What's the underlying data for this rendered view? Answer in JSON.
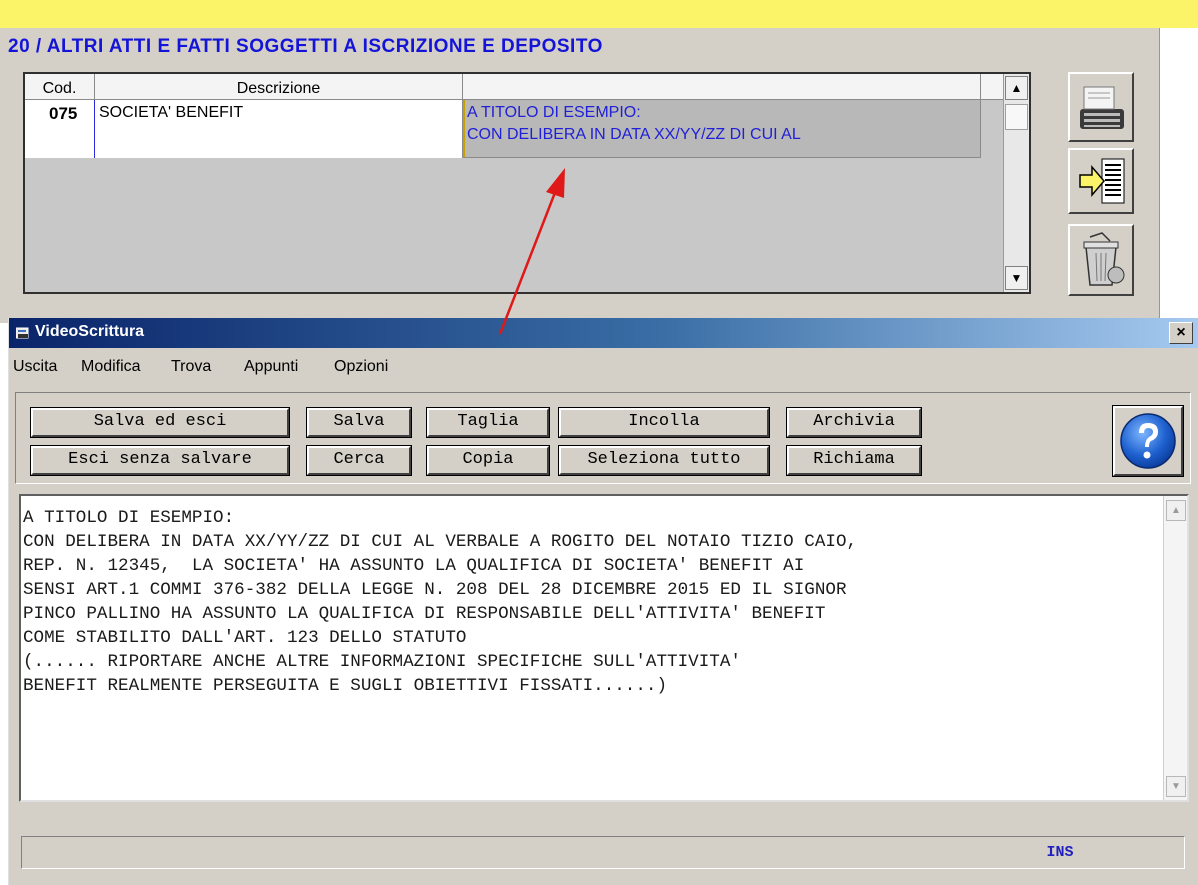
{
  "colors": {
    "accent_yellow": "#fcf468",
    "form_title_blue": "#1414d8",
    "memo_text_blue": "#2020d8",
    "titlebar_dark": "#0a246a",
    "annotation_red": "#e01818"
  },
  "form": {
    "section_title": "20 / ALTRI ATTI E FATTI SOGGETTI A ISCRIZIONE E DEPOSITO",
    "table": {
      "columns": [
        "Cod.",
        "Descrizione",
        ""
      ],
      "rows": [
        {
          "cod": "075",
          "descrizione": "SOCIETA' BENEFIT",
          "memo_lines": [
            "A TITOLO DI ESEMPIO:",
            "CON DELIBERA IN DATA XX/YY/ZZ DI CUI AL"
          ]
        }
      ]
    },
    "side_buttons": [
      "typewriter-icon",
      "insert-arrow-icon",
      "trash-bin-icon"
    ],
    "scroll_icons": {
      "up": "▲",
      "down": "▼"
    }
  },
  "dialog": {
    "title": "VideoScrittura",
    "close_label": "×",
    "menu": [
      "Uscita",
      "Modifica",
      "Trova",
      "Appunti",
      "Opzioni"
    ],
    "toolbar": {
      "salva_esci": "Salva ed esci",
      "salva": "Salva",
      "taglia": "Taglia",
      "incolla": "Incolla",
      "archivia": "Archivia",
      "esci_senza_salvare": "Esci senza salvare",
      "cerca": "Cerca",
      "copia": "Copia",
      "seleziona_tutto": "Seleziona tutto",
      "richiama": "Richiama"
    },
    "help_icon": "help-question-icon",
    "editor": {
      "lines": [
        "A TITOLO DI ESEMPIO:",
        "CON DELIBERA IN DATA XX/YY/ZZ DI CUI AL VERBALE A ROGITO DEL NOTAIO TIZIO CAIO,",
        "REP. N. 12345,  LA SOCIETA' HA ASSUNTO LA QUALIFICA DI SOCIETA' BENEFIT AI",
        "SENSI ART.1 COMMI 376-382 DELLA LEGGE N. 208 DEL 28 DICEMBRE 2015 ED IL SIGNOR",
        "PINCO PALLINO HA ASSUNTO LA QUALIFICA DI RESPONSABILE DELL'ATTIVITA' BENEFIT",
        "COME STABILITO DALL'ART. 123 DELLO STATUTO",
        "(...... RIPORTARE ANCHE ALTRE INFORMAZIONI SPECIFICHE SULL'ATTIVITA'",
        "BENEFIT REALMENTE PERSEGUITA E SUGLI OBIETTIVI FISSATI......)"
      ],
      "scroll_up": "▲",
      "scroll_down": "▼"
    },
    "status": {
      "mode": "INS"
    }
  }
}
